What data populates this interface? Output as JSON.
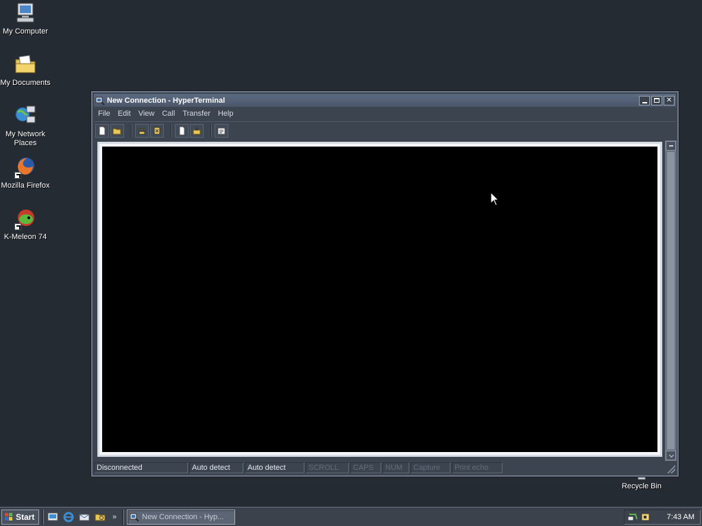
{
  "desktop": {
    "icons": [
      {
        "label": "My Computer",
        "icon": "computer-icon"
      },
      {
        "label": "My Documents",
        "icon": "documents-folder-icon"
      },
      {
        "label": "My Network Places",
        "icon": "network-places-icon"
      },
      {
        "label": "Mozilla Firefox",
        "icon": "firefox-icon"
      },
      {
        "label": "K-Meleon 74",
        "icon": "k-meleon-icon"
      },
      {
        "label": "Recycle Bin",
        "icon": "recycle-bin-icon"
      }
    ]
  },
  "window": {
    "title": "New Connection - HyperTerminal",
    "menu": [
      "File",
      "Edit",
      "View",
      "Call",
      "Transfer",
      "Help"
    ],
    "toolbar": [
      {
        "icon": "new-file-icon"
      },
      {
        "icon": "open-folder-icon"
      },
      {
        "icon": "call-phone-icon"
      },
      {
        "icon": "disconnect-icon"
      },
      {
        "icon": "send-file-icon"
      },
      {
        "icon": "receive-file-icon"
      },
      {
        "icon": "properties-icon"
      }
    ],
    "status": {
      "connection": "Disconnected",
      "detect1": "Auto detect",
      "detect2": "Auto detect",
      "scroll": "SCROLL",
      "caps": "CAPS",
      "num": "NUM",
      "capture": "Capture",
      "print_echo": "Print echo"
    }
  },
  "taskbar": {
    "start_label": "Start",
    "quick_launch": [
      "show-desktop-icon",
      "internet-explorer-icon",
      "outlook-express-icon",
      "explorer-icon"
    ],
    "more": "»",
    "task_label": "New Connection - Hyp...",
    "clock": "7:43 AM"
  },
  "colors": {
    "desktop_bg": "#252b33",
    "window_bg": "#3c4450",
    "terminal_bg": "#000000",
    "title_gradient": "#5d6b82"
  }
}
